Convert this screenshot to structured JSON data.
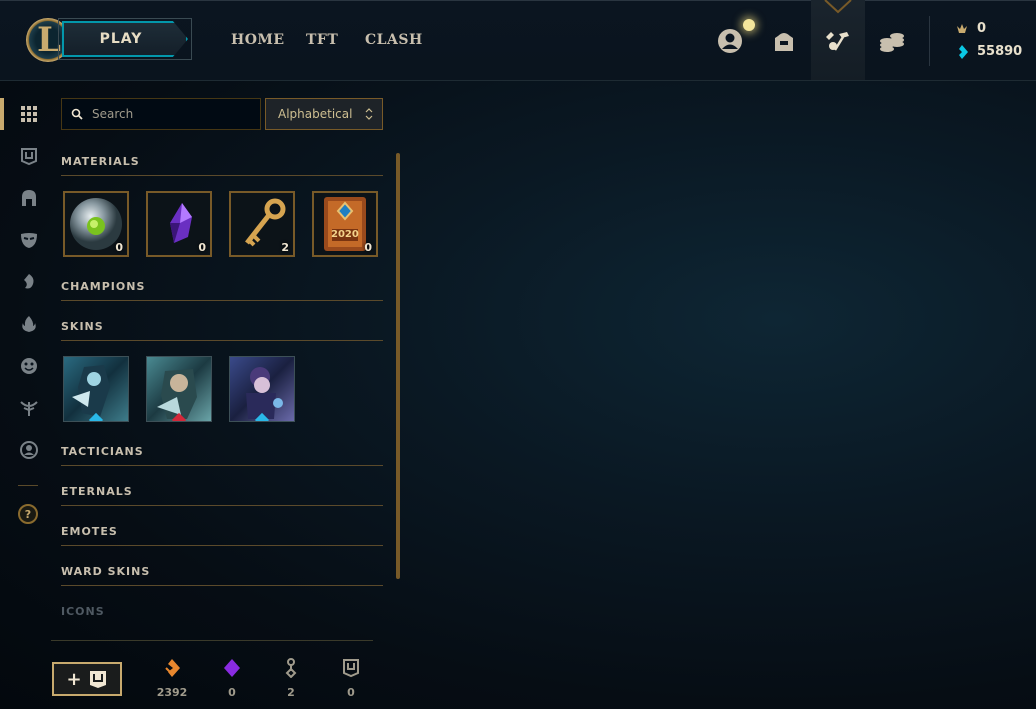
{
  "header": {
    "play_label": "PLAY",
    "nav": [
      "HOME",
      "TFT",
      "CLASH"
    ],
    "currency": {
      "rp": "0",
      "blue_essence": "55890"
    }
  },
  "search": {
    "placeholder": "Search"
  },
  "sort": {
    "selected": "Alphabetical"
  },
  "sections": {
    "materials": "MATERIALS",
    "champions": "CHAMPIONS",
    "skins": "SKINS",
    "tacticians": "TACTICIANS",
    "eternals": "ETERNALS",
    "emotes": "EMOTES",
    "ward_skins": "WARD SKINS",
    "icons": "ICONS"
  },
  "materials": [
    {
      "name": "Mystery orb",
      "count": "0"
    },
    {
      "name": "Purple crystal",
      "count": "0"
    },
    {
      "name": "Key fragment",
      "count": "2"
    },
    {
      "name": "2020 capsule",
      "count": "0",
      "label": "2020"
    }
  ],
  "skins": [
    {
      "name": "Skin shard 1",
      "gem": "blue"
    },
    {
      "name": "Skin shard 2",
      "gem": "red"
    },
    {
      "name": "Skin shard 3",
      "gem": "blue"
    }
  ],
  "footer": {
    "craft_label": "+",
    "orange_essence": "2392",
    "mythic_essence": "0",
    "key_fragments": "2",
    "chests": "0"
  },
  "colors": {
    "gold": "#c8aa6e",
    "teal": "#0397ab",
    "orange": "#e8872e",
    "purple": "#8a2be2"
  }
}
